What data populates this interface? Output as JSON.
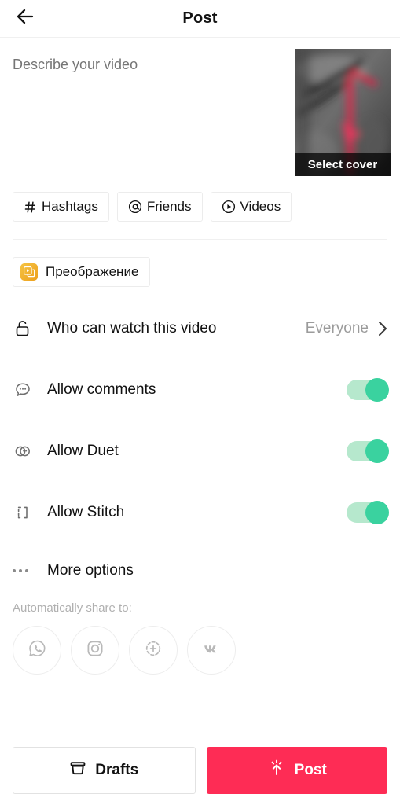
{
  "header": {
    "title": "Post",
    "back_icon": "arrow-left-icon"
  },
  "description": {
    "placeholder": "Describe your video",
    "value": ""
  },
  "cover": {
    "label": "Select cover"
  },
  "chips": [
    {
      "label": "Hashtags",
      "icon": "hashtag-icon"
    },
    {
      "label": "Friends",
      "icon": "at-mention-icon"
    },
    {
      "label": "Videos",
      "icon": "play-circle-icon"
    }
  ],
  "effect": {
    "label": "Преображение",
    "icon": "effect-play-icon",
    "icon_color": "#eda01e"
  },
  "settings": [
    {
      "label": "Who can watch this video",
      "icon": "unlock-icon",
      "type": "value",
      "value": "Everyone",
      "chevron": "chevron-right-icon"
    },
    {
      "label": "Allow comments",
      "icon": "comment-bubble-icon",
      "type": "toggle",
      "on": true
    },
    {
      "label": "Allow Duet",
      "icon": "duet-icon",
      "type": "toggle",
      "on": true
    },
    {
      "label": "Allow Stitch",
      "icon": "stitch-icon",
      "type": "toggle",
      "on": true
    }
  ],
  "more_options": {
    "label": "More options",
    "icon": "ellipsis-icon"
  },
  "share": {
    "title": "Automatically share to:",
    "targets": [
      {
        "name": "whatsapp-icon"
      },
      {
        "name": "instagram-icon"
      },
      {
        "name": "instagram-story-icon"
      },
      {
        "name": "vk-icon"
      }
    ]
  },
  "bottom": {
    "drafts_label": "Drafts",
    "drafts_icon": "archive-box-icon",
    "post_label": "Post",
    "post_icon": "upload-sparkle-icon"
  },
  "colors": {
    "accent_red": "#FE2C55",
    "toggle_on_knob": "#3ad29f",
    "toggle_on_track": "#b6e8cd",
    "text_primary": "#121212",
    "text_muted": "#9b9b9b"
  }
}
